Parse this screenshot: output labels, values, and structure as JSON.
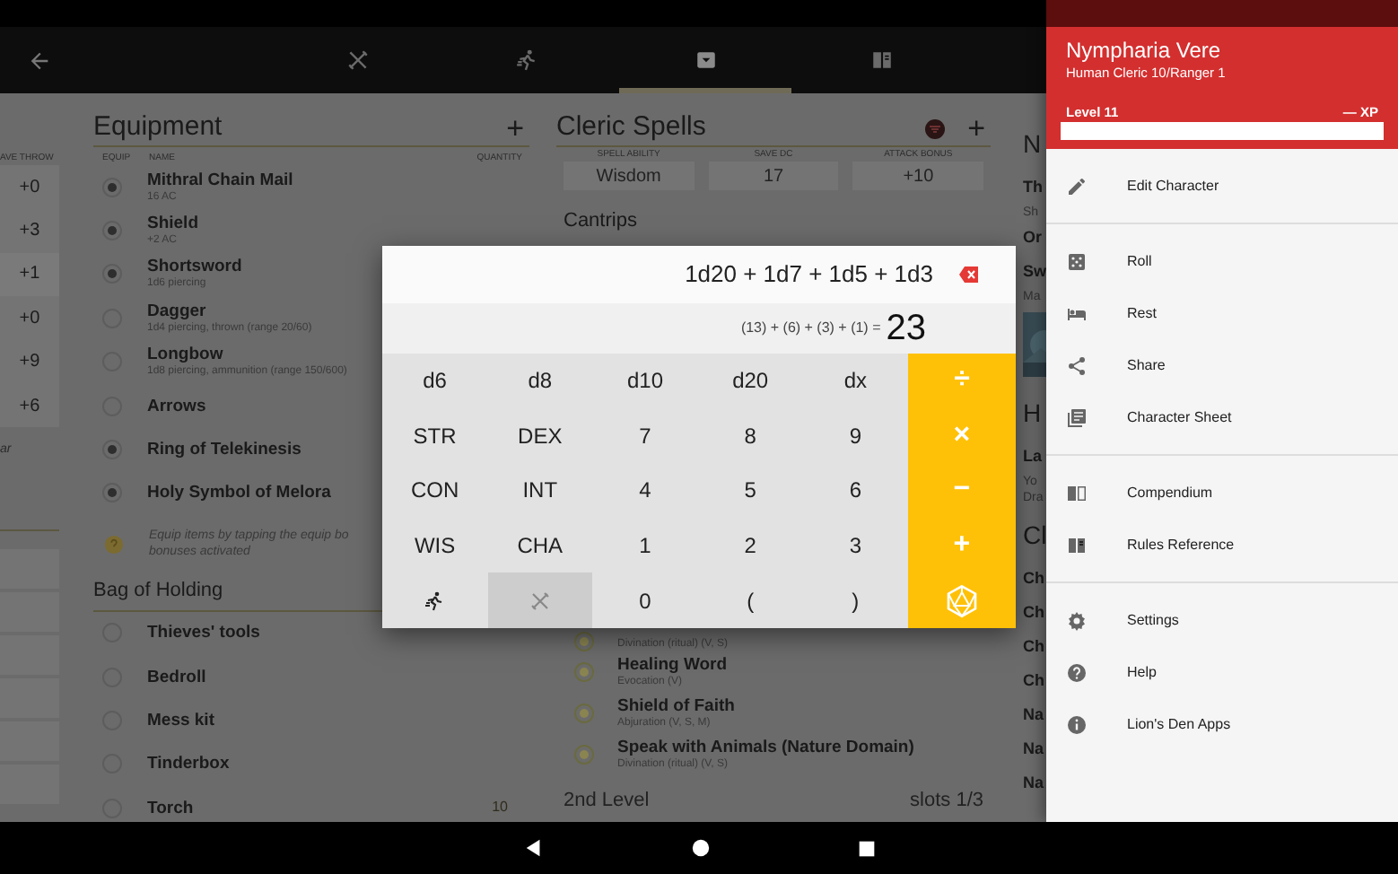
{
  "app_bar": {
    "tabs": [
      {
        "kind": "swords",
        "selected": false
      },
      {
        "kind": "runner",
        "selected": false
      },
      {
        "kind": "chest",
        "selected": true
      },
      {
        "kind": "book",
        "selected": false
      }
    ]
  },
  "saves": {
    "header": "AVE THROW",
    "values": [
      "+0",
      "+3",
      "+1",
      "+0",
      "+9",
      "+6"
    ],
    "note": "ar"
  },
  "equipment": {
    "title": "Equipment",
    "add": "+",
    "columns": [
      "EQUIP",
      "NAME",
      "QUANTITY"
    ],
    "items": [
      {
        "kind": "item",
        "name": "Mithral Chain Mail",
        "detail": "16 AC",
        "equipped": true
      },
      {
        "kind": "item",
        "name": "Shield",
        "detail": "+2 AC",
        "equipped": true
      },
      {
        "kind": "item",
        "name": "Shortsword",
        "detail": "1d6 piercing",
        "equipped": true
      },
      {
        "kind": "item",
        "name": "Dagger",
        "detail": "1d4 piercing, thrown (range 20/60)",
        "equipped": false
      },
      {
        "kind": "item",
        "name": "Longbow",
        "detail": "1d8 piercing, ammunition (range 150/600)",
        "equipped": false
      },
      {
        "kind": "item",
        "name": "Arrows",
        "equipped": false
      },
      {
        "kind": "item",
        "name": "Ring of Telekinesis",
        "equipped": true
      },
      {
        "kind": "item",
        "name": "Holy Symbol of Melora",
        "equipped": true
      },
      {
        "kind": "hint",
        "name": "Equip items by tapping the equip bo",
        "detail": "bonuses activated"
      }
    ],
    "bag": {
      "title": "Bag of Holding",
      "items": [
        {
          "kind": "item",
          "name": "Thieves' tools",
          "equipped": false
        },
        {
          "kind": "item",
          "name": "Bedroll",
          "equipped": false
        },
        {
          "kind": "item",
          "name": "Mess kit",
          "equipped": false
        },
        {
          "kind": "item",
          "name": "Tinderbox",
          "equipped": false
        },
        {
          "kind": "item",
          "name": "Torch",
          "quantity": "10",
          "equipped": false
        }
      ]
    }
  },
  "spells": {
    "title": "Cleric Spells",
    "add": "+",
    "stats": [
      {
        "label": "SPELL ABILITY",
        "value": "Wisdom"
      },
      {
        "label": "SAVE DC",
        "value": "17"
      },
      {
        "label": "ATTACK BONUS",
        "value": "+10"
      }
    ],
    "cantrips": "Cantrips",
    "items": [
      {
        "detail": "Divination (ritual) (V, S)",
        "prepared": true
      },
      {
        "name": "Healing Word",
        "detail": "Evocation (V)",
        "prepared": true
      },
      {
        "name": "Shield of Faith",
        "detail": "Abjuration (V, S, M)",
        "prepared": true
      },
      {
        "name": "Speak with Animals (Nature Domain)",
        "detail": "Divination (ritual) (V, S)",
        "prepared": true
      }
    ],
    "level": "2nd Level",
    "slots": "slots 1/3"
  },
  "notes": [
    {
      "kind": "heading",
      "text": "N"
    },
    {
      "kind": "title",
      "text": "Th"
    },
    {
      "kind": "sub",
      "text": "Sh"
    },
    {
      "kind": "title",
      "text": "Or"
    },
    {
      "kind": "title",
      "text": "Sw"
    },
    {
      "kind": "sub",
      "text": "Ma"
    },
    {
      "kind": "picture"
    },
    {
      "kind": "heading",
      "text": "H"
    },
    {
      "kind": "title",
      "text": "La"
    },
    {
      "kind": "sub",
      "text": "Yo"
    },
    {
      "kind": "sub",
      "text": "Dra"
    },
    {
      "kind": "heading",
      "text": "Cl"
    },
    {
      "kind": "title",
      "text": "Ch"
    },
    {
      "kind": "title",
      "text": "Ch"
    },
    {
      "kind": "title",
      "text": "Ch"
    },
    {
      "kind": "title",
      "text": "Ch"
    },
    {
      "kind": "title",
      "text": "Na"
    },
    {
      "kind": "title",
      "text": "Na"
    },
    {
      "kind": "title",
      "text": "Na"
    }
  ],
  "dice_dialog": {
    "expression": "1d20 + 1d7 + 1d5 + 1d3",
    "breakdown": "(13) + (6) + (3) + (1) =",
    "result": "23",
    "keys": [
      {
        "kind": "key",
        "label": "d6",
        "selected": false
      },
      {
        "kind": "key",
        "label": "d8",
        "selected": false
      },
      {
        "kind": "key",
        "label": "d10",
        "selected": false
      },
      {
        "kind": "key",
        "label": "d20",
        "selected": false
      },
      {
        "kind": "key",
        "label": "dx",
        "selected": false
      },
      {
        "kind": "op",
        "label": "÷",
        "selected": false
      },
      {
        "kind": "key",
        "label": "STR",
        "selected": false
      },
      {
        "kind": "key",
        "label": "DEX",
        "selected": false
      },
      {
        "kind": "key",
        "label": "7",
        "selected": false
      },
      {
        "kind": "key",
        "label": "8",
        "selected": false
      },
      {
        "kind": "key",
        "label": "9",
        "selected": false
      },
      {
        "kind": "op",
        "label": "×",
        "selected": false
      },
      {
        "kind": "key",
        "label": "CON",
        "selected": false
      },
      {
        "kind": "key",
        "label": "INT",
        "selected": false
      },
      {
        "kind": "key",
        "label": "4",
        "selected": false
      },
      {
        "kind": "key",
        "label": "5",
        "selected": false
      },
      {
        "kind": "key",
        "label": "6",
        "selected": false
      },
      {
        "kind": "op",
        "label": "−",
        "selected": false
      },
      {
        "kind": "key",
        "label": "WIS",
        "selected": false
      },
      {
        "kind": "key",
        "label": "CHA",
        "selected": false
      },
      {
        "kind": "key",
        "label": "1",
        "selected": false
      },
      {
        "kind": "key",
        "label": "2",
        "selected": false
      },
      {
        "kind": "key",
        "label": "3",
        "selected": false
      },
      {
        "kind": "op",
        "label": "+",
        "selected": false
      },
      {
        "kind": "runner",
        "selected": false
      },
      {
        "kind": "swords",
        "selected": true
      },
      {
        "kind": "key",
        "label": "0",
        "selected": false
      },
      {
        "kind": "key",
        "label": "(",
        "selected": false
      },
      {
        "kind": "key",
        "label": ")",
        "selected": false
      },
      {
        "kind": "roll",
        "selected": false
      }
    ]
  },
  "drawer": {
    "name": "Nympharia Vere",
    "subtitle": "Human Cleric 10/Ranger 1",
    "level": "Level 11",
    "xp": "— XP",
    "groups": [
      [
        {
          "kind": "pencil",
          "label": "Edit Character"
        }
      ],
      [
        {
          "kind": "dice",
          "label": "Roll"
        },
        {
          "kind": "bed",
          "label": "Rest"
        },
        {
          "kind": "share",
          "label": "Share"
        },
        {
          "kind": "sheet",
          "label": "Character Sheet"
        }
      ],
      [
        {
          "kind": "book-open",
          "label": "Compendium"
        },
        {
          "kind": "book",
          "label": "Rules Reference"
        }
      ],
      [
        {
          "kind": "gear",
          "label": "Settings"
        },
        {
          "kind": "help",
          "label": "Help"
        },
        {
          "kind": "info",
          "label": "Lion's Den Apps"
        }
      ]
    ]
  }
}
